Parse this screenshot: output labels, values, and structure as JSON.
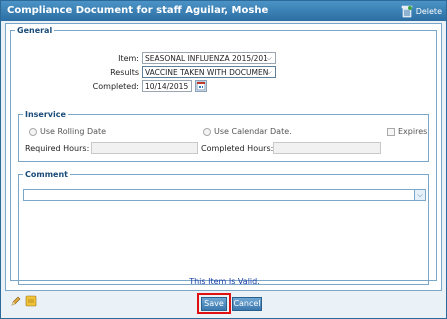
{
  "dialog": {
    "title": "Compliance Document for staff Aguilar, Moshe",
    "delete_label": "Delete"
  },
  "general": {
    "legend": "General",
    "item_label": "Item:",
    "item_value": "SEASONAL INFLUENZA 2015/201",
    "results_label": "Results",
    "results_value": "VACCINE TAKEN WITH DOCUMEN",
    "completed_label": "Completed:",
    "completed_value": "10/14/2015"
  },
  "inservice": {
    "legend": "Inservice",
    "rolling_label": "Use Rolling Date",
    "calendar_label": "Use Calendar Date.",
    "expires_label": "Expires",
    "required_label": "Required Hours:",
    "completed_hours_label": "Completed Hours:"
  },
  "comment": {
    "legend": "Comment"
  },
  "status": {
    "message": "This Item Is Valid."
  },
  "footer": {
    "save_label": "Save",
    "cancel_label": "Cancel"
  },
  "colors": {
    "titlebar": "#2c6ea3",
    "accent": "#1a4c7a",
    "highlight": "#e01010",
    "valid_text": "#1a3fa8"
  },
  "icons": [
    "trash-icon",
    "calendar-icon",
    "pencil-icon",
    "notes-icon",
    "chevron-down-icon"
  ]
}
